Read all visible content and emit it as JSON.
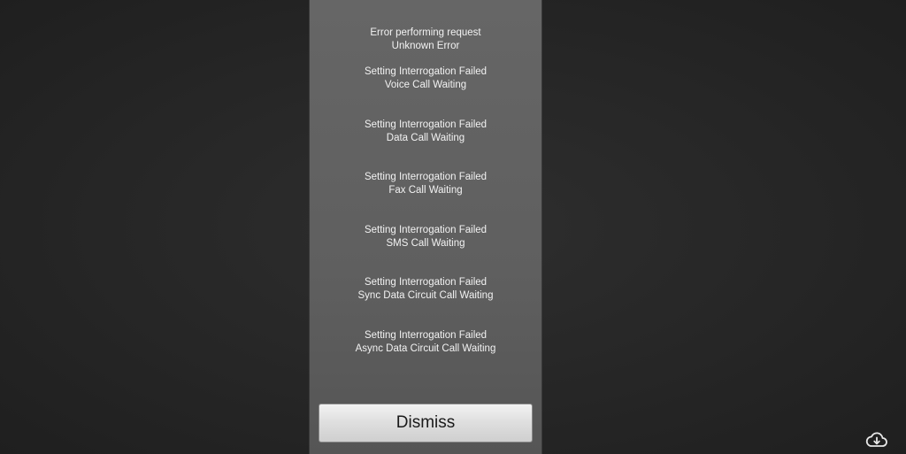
{
  "dialog": {
    "header": {
      "line1": "Error performing request",
      "line2": "Unknown Error"
    },
    "items": [
      {
        "status": "Setting Interrogation Failed",
        "service": "Voice Call Waiting"
      },
      {
        "status": "Setting Interrogation Failed",
        "service": "Data Call Waiting"
      },
      {
        "status": "Setting Interrogation Failed",
        "service": "Fax Call Waiting"
      },
      {
        "status": "Setting Interrogation Failed",
        "service": "SMS Call Waiting"
      },
      {
        "status": "Setting Interrogation Failed",
        "service": "Sync Data Circuit Call Waiting"
      },
      {
        "status": "Setting Interrogation Failed",
        "service": "Async Data Circuit Call Waiting"
      }
    ],
    "dismiss_label": "Dismiss"
  },
  "overlay_icon": {
    "name": "cloud-download-icon"
  },
  "colors": {
    "background": "#262626",
    "panel": "#636363",
    "text": "#f2f2f2",
    "button": "#dcdcdc"
  }
}
